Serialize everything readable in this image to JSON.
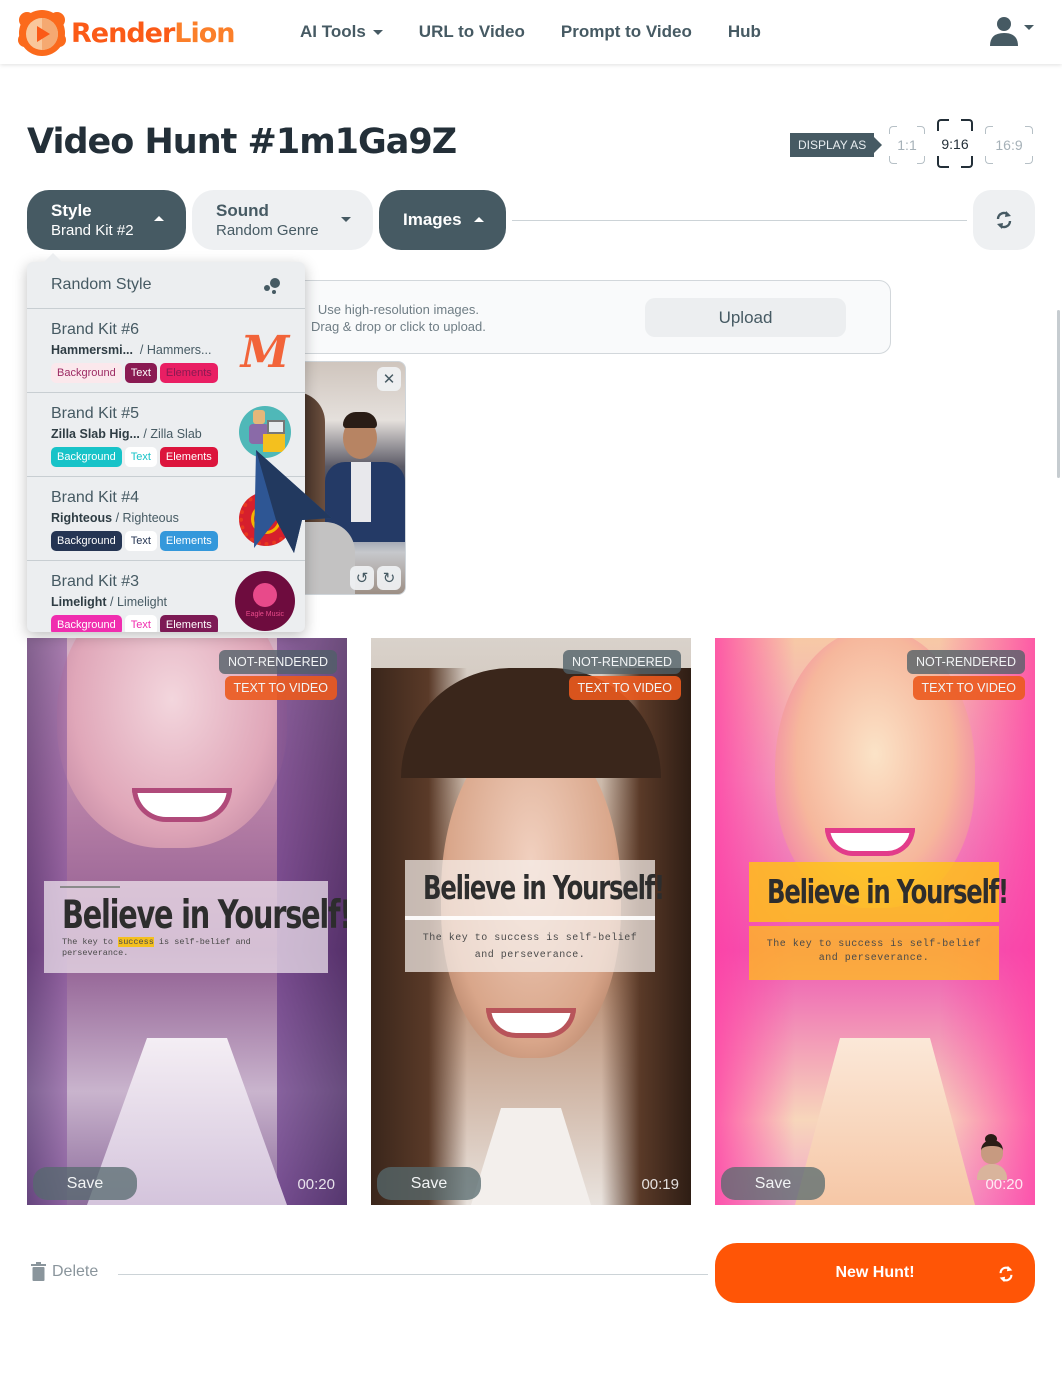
{
  "app": {
    "brand_part1": "Render",
    "brand_part2": "Lion",
    "brand_color": "#fb5a17"
  },
  "nav": {
    "links": [
      {
        "label": "AI Tools",
        "has_dropdown": true
      },
      {
        "label": "URL to Video",
        "has_dropdown": false
      },
      {
        "label": "Prompt to Video",
        "has_dropdown": false
      },
      {
        "label": "Hub",
        "has_dropdown": false
      }
    ],
    "user_icon": "user-icon"
  },
  "page": {
    "title": "Video Hunt #1m1Ga9Z"
  },
  "display": {
    "label": "DISPLAY AS",
    "ratios": [
      {
        "label": "1:1",
        "active": false
      },
      {
        "label": "9:16",
        "active": true
      },
      {
        "label": "16:9",
        "active": false
      }
    ]
  },
  "toolbar": {
    "style": {
      "title": "Style",
      "value": "Brand Kit #2",
      "expanded": true
    },
    "sound": {
      "title": "Sound",
      "value": "Random Genre",
      "expanded": false
    },
    "images": {
      "title": "Images",
      "expanded": true
    },
    "refresh_icon": "refresh-icon"
  },
  "style_dropdown": {
    "random_label": "Random Style",
    "items": [
      {
        "name": "Brand Kit #6",
        "font_primary": "Hammersmi...",
        "font_secondary": "Hammers...",
        "tags": [
          {
            "label": "Background",
            "bg": "#fbe8ec",
            "fg": "#9c2a63"
          },
          {
            "label": "Text",
            "bg": "#8a1a52",
            "fg": "#ffffff"
          },
          {
            "label": "Elements",
            "bg": "#e91e63",
            "fg": "#8a1a52"
          }
        ]
      },
      {
        "name": "Brand Kit #5",
        "font_primary": "Zilla Slab Hig...",
        "font_secondary": "Zilla Slab",
        "tags": [
          {
            "label": "Background",
            "bg": "#17c3c8",
            "fg": "#ffffff"
          },
          {
            "label": "Text",
            "bg": "#ffffff",
            "fg": "#17c3c8"
          },
          {
            "label": "Elements",
            "bg": "#dc143c",
            "fg": "#ffffff"
          }
        ]
      },
      {
        "name": "Brand Kit #4",
        "font_primary": "Righteous",
        "font_secondary": "Righteous",
        "tags": [
          {
            "label": "Background",
            "bg": "#253553",
            "fg": "#ffffff"
          },
          {
            "label": "Text",
            "bg": "#ffffff",
            "fg": "#253553"
          },
          {
            "label": "Elements",
            "bg": "#3498db",
            "fg": "#ffffff"
          }
        ]
      },
      {
        "name": "Brand Kit #3",
        "font_primary": "Limelight",
        "font_secondary": "Limelight",
        "tags": [
          {
            "label": "Background",
            "bg": "#f02daf",
            "fg": "#ffffff"
          },
          {
            "label": "Text",
            "bg": "#ffffff",
            "fg": "#f02daf"
          },
          {
            "label": "Elements",
            "bg": "#7d1a55",
            "fg": "#ffffff"
          }
        ]
      }
    ],
    "kit3_logo_text": "Eagle Music"
  },
  "images_panel": {
    "hint_line1": "Use high-resolution images.",
    "hint_line2": "Drag & drop or click to upload.",
    "upload_label": "Upload"
  },
  "videos": [
    {
      "status": "NOT-RENDERED",
      "type": "TEXT TO VIDEO",
      "headline": "Believe in Yourself!",
      "subtitle": "The key to success is self-belief and perseverance.",
      "highlight_word": "success",
      "save_label": "Save",
      "duration": "00:20"
    },
    {
      "status": "NOT-RENDERED",
      "type": "TEXT TO VIDEO",
      "headline": "Believe in Yourself!",
      "subtitle": "The key to success is self-belief and perseverance.",
      "save_label": "Save",
      "duration": "00:19"
    },
    {
      "status": "NOT-RENDERED",
      "type": "TEXT TO VIDEO",
      "headline": "Believe in Yourself!",
      "subtitle": "The key to success is self-belief and perseverance.",
      "save_label": "Save",
      "duration": "00:20"
    }
  ],
  "footer": {
    "delete_label": "Delete",
    "new_hunt_label": "New Hunt!",
    "new_hunt_color": "#ff5506"
  }
}
